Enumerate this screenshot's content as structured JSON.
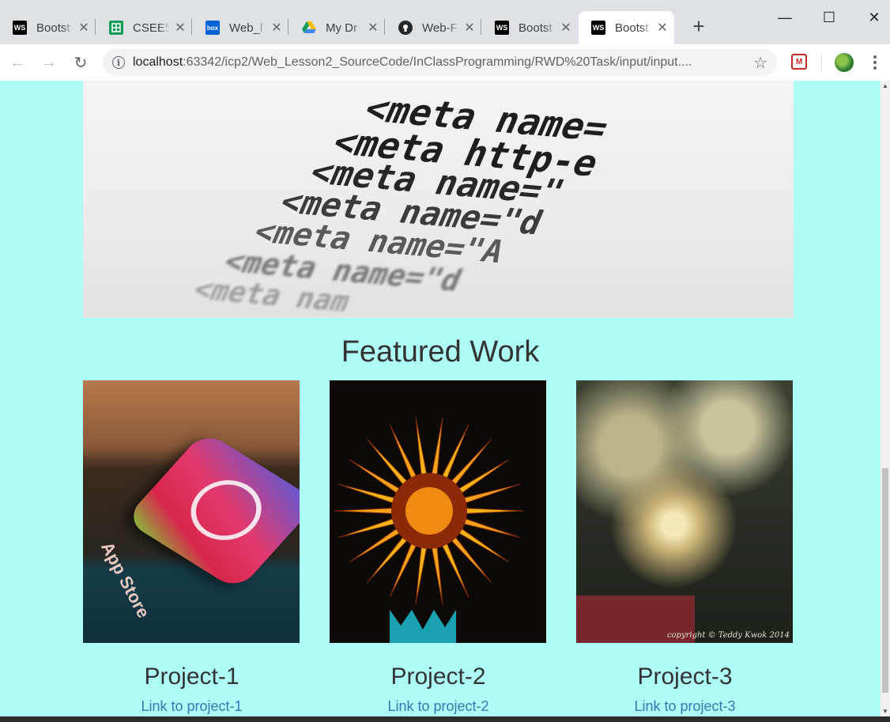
{
  "browser": {
    "tabs": [
      {
        "title": "Bootst",
        "favicon": "ws-icon",
        "color": "#000000"
      },
      {
        "title": "CSEE5",
        "favicon": "sheets-icon",
        "color": "#0f9d58"
      },
      {
        "title": "Web_l",
        "favicon": "box-icon",
        "color": "#0061d5"
      },
      {
        "title": "My Dr",
        "favicon": "drive-icon",
        "color": "#fbbc04"
      },
      {
        "title": "Web-F",
        "favicon": "github-icon",
        "color": "#24292e"
      },
      {
        "title": "Bootst",
        "favicon": "ws-icon",
        "color": "#000000"
      },
      {
        "title": "Bootst",
        "favicon": "ws-icon",
        "color": "#000000",
        "active": true
      }
    ],
    "favicon_text": {
      "ws": "WS",
      "box": "box"
    },
    "address": {
      "host": "localhost",
      "path": ":63342/icp2/Web_Lesson2_SourceCode/InClassProgramming/RWD%20Task/input/input...."
    },
    "glyphs": {
      "close": "✕",
      "new_tab": "+",
      "minimize": "—",
      "maximize": "☐",
      "window_close": "✕",
      "back": "←",
      "forward": "→",
      "reload": "↻",
      "info": "i",
      "star": "☆",
      "ext": "M",
      "scroll_up": "▲",
      "scroll_down": "▼"
    }
  },
  "page": {
    "hero_code_lines": [
      "<meta name=",
      "<meta http-e",
      "<meta name=\"",
      "<meta name=\"d",
      "<meta name=\"A",
      "<meta name=\"d",
      "<meta nam"
    ],
    "section_title": "Featured Work",
    "projects": [
      {
        "name": "Project-1",
        "link": "Link to project-1"
      },
      {
        "name": "Project-2",
        "link": "Link to project-2"
      },
      {
        "name": "Project-3",
        "link": "Link to project-3"
      }
    ],
    "image_text": {
      "app_store": "App Store",
      "copyright": "copyright © Teddy Kwok 2014"
    },
    "colors": {
      "background": "#aefcf6",
      "link": "#337ab7",
      "heading": "#333333"
    }
  }
}
